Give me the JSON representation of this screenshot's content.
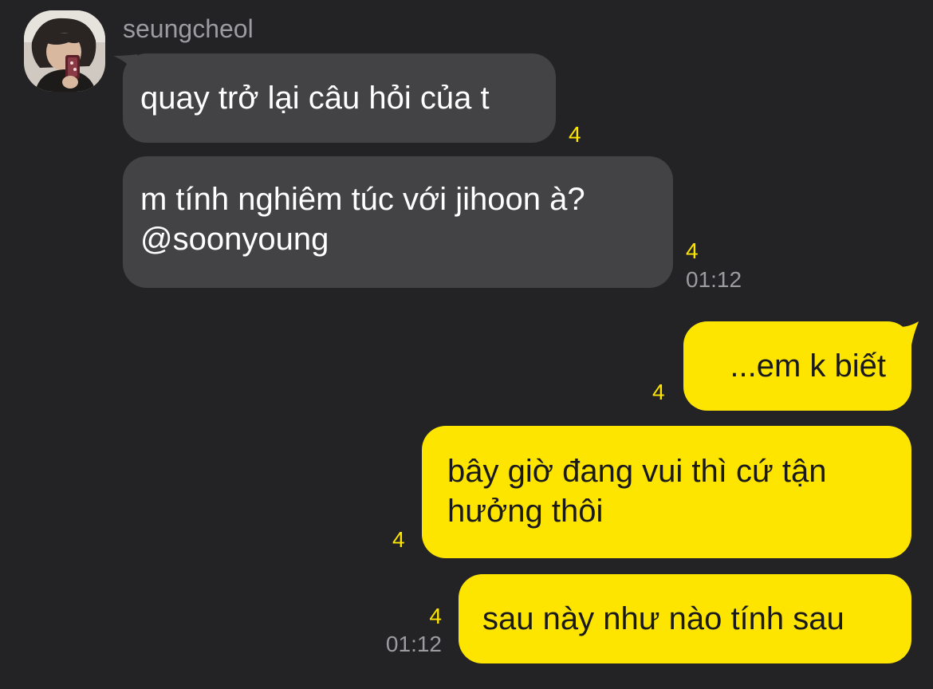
{
  "sender": {
    "name": "seungcheol",
    "avatar_icon": "user-avatar-photo"
  },
  "messages": [
    {
      "direction": "incoming",
      "text": "quay trở lại câu hỏi của t",
      "unread": "4",
      "time": ""
    },
    {
      "direction": "incoming",
      "lines": [
        "m tính nghiêm túc với jihoon à?",
        "@soonyoung"
      ],
      "unread": "4",
      "time": "01:12"
    },
    {
      "direction": "outgoing",
      "text": "...em k biết",
      "unread": "4",
      "time": ""
    },
    {
      "direction": "outgoing",
      "lines": [
        "bây giờ đang vui thì cứ tận",
        "hưởng thôi"
      ],
      "unread": "4",
      "time": ""
    },
    {
      "direction": "outgoing",
      "text": "sau này như nào tính sau",
      "unread": "4",
      "time": "01:12"
    }
  ],
  "colors": {
    "background": "#232325",
    "incoming_bubble": "#434345",
    "outgoing_bubble": "#fee500",
    "unread_count": "#fee500",
    "timestamp": "#9c9ca0"
  }
}
